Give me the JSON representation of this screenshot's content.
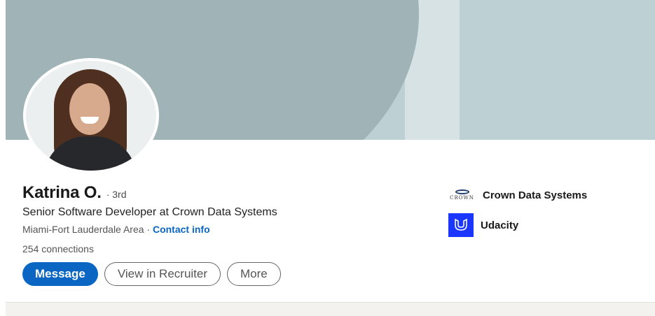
{
  "profile": {
    "name": "Katrina O.",
    "degree": "· 3rd",
    "headline": "Senior Software Developer at Crown Data Systems",
    "location": "Miami-Fort Lauderdale Area ·",
    "contact_info": "Contact info",
    "connections": "254 connections"
  },
  "actions": {
    "message": "Message",
    "view_in_recruiter": "View in Recruiter",
    "more": "More"
  },
  "orgs": [
    {
      "name": "Crown Data Systems",
      "logo_text": "CROWN",
      "icon": "crown-data-systems-logo"
    },
    {
      "name": "Udacity",
      "icon": "udacity-logo",
      "color": "#1a36ff"
    }
  ],
  "colors": {
    "accent": "#0a66c2",
    "banner": "#bdd0d4",
    "banner_shape": "#a0b3b6"
  }
}
